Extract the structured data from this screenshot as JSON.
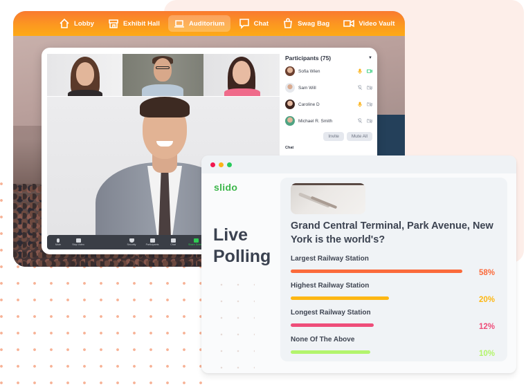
{
  "nav": {
    "items": [
      {
        "label": "Lobby",
        "icon": "home-icon",
        "active": false
      },
      {
        "label": "Exhibit Hall",
        "icon": "storefront-icon",
        "active": false
      },
      {
        "label": "Auditorium",
        "icon": "laptop-icon",
        "active": true
      },
      {
        "label": "Chat",
        "icon": "chat-bubble-icon",
        "active": false
      },
      {
        "label": "Swag Bag",
        "icon": "shopping-bag-icon",
        "active": false
      },
      {
        "label": "Video Vault",
        "icon": "video-camera-icon",
        "active": false
      }
    ]
  },
  "meeting": {
    "toolbar": {
      "items": [
        {
          "label": "Mute",
          "icon": "microphone-icon"
        },
        {
          "label": "Stop Video",
          "icon": "video-camera-icon"
        },
        {
          "label": "Security",
          "icon": "shield-icon"
        },
        {
          "label": "Participants",
          "icon": "people-icon"
        },
        {
          "label": "Chat",
          "icon": "chat-icon"
        },
        {
          "label": "Share Screen",
          "icon": "share-screen-icon",
          "highlight": true
        }
      ]
    },
    "participants": {
      "title": "Participants (75)",
      "list": [
        {
          "name": "Sofia Wien",
          "mic": "on",
          "video": "on"
        },
        {
          "name": "Sam Will",
          "mic": "off",
          "video": "off"
        },
        {
          "name": "Caroline D",
          "mic": "on",
          "video": "off"
        },
        {
          "name": "Michael R. Smith",
          "mic": "off",
          "video": "off"
        }
      ],
      "invite_label": "Invite",
      "mute_all_label": "Mute All",
      "chat_label": "Chat"
    }
  },
  "slido": {
    "window_dots": [
      "#f0184f",
      "#fbb217",
      "#27c95b"
    ],
    "logo": "slido",
    "title_line1": "Live",
    "title_line2": "Polling",
    "poll": {
      "question": "Grand Central Terminal, Park Avenue, New York is the world's?",
      "options": [
        {
          "label": "Largest Railway Station",
          "percent": 58,
          "percent_label": "58%",
          "color": "#fb6a3b"
        },
        {
          "label": "Highest Railway Station",
          "percent": 20,
          "percent_label": "20%",
          "color": "#fdb713"
        },
        {
          "label": "Longest Railway Station",
          "percent": 12,
          "percent_label": "12%",
          "color": "#ee4d79"
        },
        {
          "label": "None Of The Above",
          "percent": 10,
          "percent_label": "10%",
          "color": "#b3f46c"
        }
      ]
    }
  }
}
